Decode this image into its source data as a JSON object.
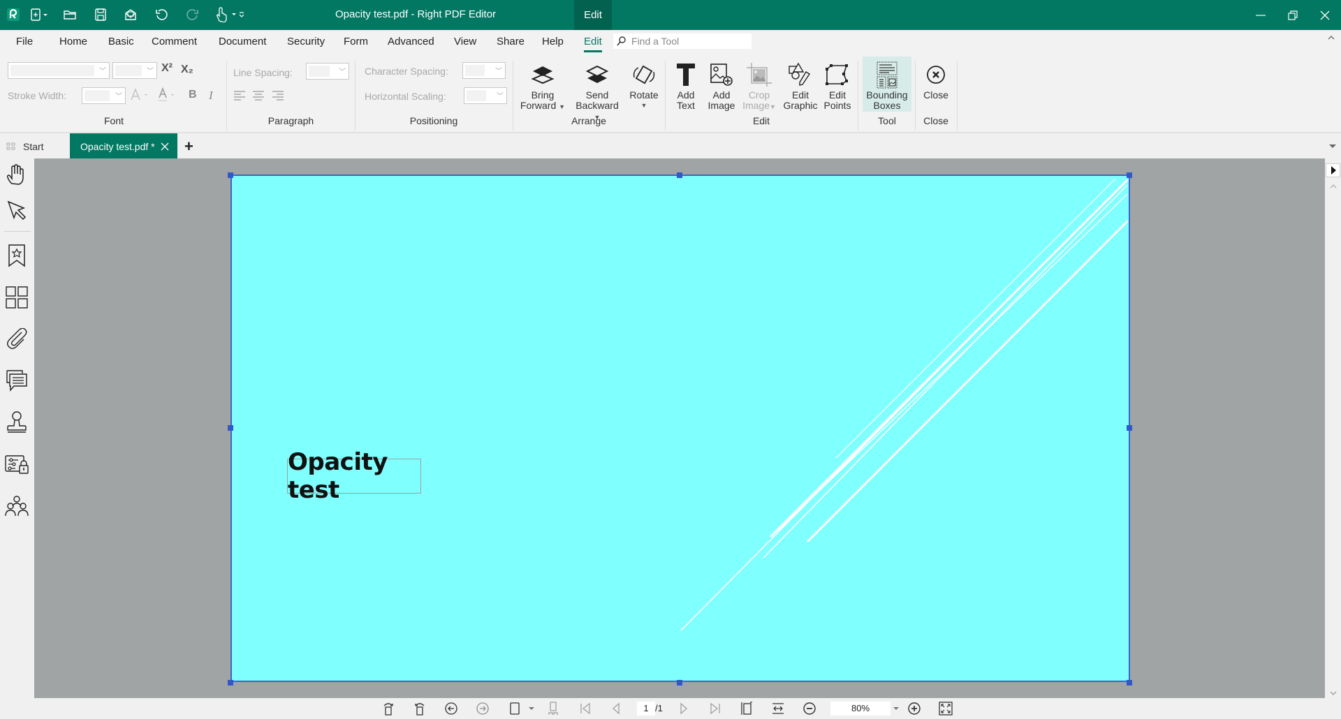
{
  "app": {
    "title": "Opacity test.pdf - Right PDF Editor",
    "context_tab": "Edit",
    "colors": {
      "brand": "#027862",
      "page_fill": "#80ffff",
      "selection": "#3d65c8"
    }
  },
  "quick_access": [
    "app-logo-icon",
    "new-document-icon",
    "open-folder-icon",
    "save-icon",
    "print-icon",
    "undo-icon",
    "redo-icon",
    "hand-tool-icon",
    "customize-icon"
  ],
  "menu": {
    "items": [
      {
        "label": "File"
      },
      {
        "label": "Home"
      },
      {
        "label": "Basic"
      },
      {
        "label": "Comment"
      },
      {
        "label": "Document"
      },
      {
        "label": "Security"
      },
      {
        "label": "Form"
      },
      {
        "label": "Advanced"
      },
      {
        "label": "View"
      },
      {
        "label": "Share"
      },
      {
        "label": "Help"
      },
      {
        "label": "Edit",
        "active": true
      }
    ],
    "search_placeholder": "Find a Tool"
  },
  "ribbon": {
    "font": {
      "group_label": "Font",
      "font_name_value": "",
      "font_size_value": "",
      "stroke_width_label": "Stroke Width:",
      "superscript": "X²",
      "subscript": "X₂",
      "bold": "B",
      "italic": "I"
    },
    "paragraph": {
      "group_label": "Paragraph",
      "line_spacing_label": "Line Spacing:"
    },
    "positioning": {
      "group_label": "Positioning",
      "char_spacing_label": "Character Spacing:",
      "horiz_scaling_label": "Horizontal Scaling:"
    },
    "arrange": {
      "group_label": "Arrange",
      "bring_forward": [
        "Bring",
        "Forward"
      ],
      "send_backward": [
        "Send",
        "Backward"
      ],
      "rotate": "Rotate"
    },
    "edit": {
      "group_label": "Edit",
      "add_text": [
        "Add",
        "Text"
      ],
      "add_image": [
        "Add",
        "Image"
      ],
      "crop_image": [
        "Crop",
        "Image"
      ],
      "edit_graphic": [
        "Edit",
        "Graphic"
      ],
      "edit_points": [
        "Edit",
        "Points"
      ]
    },
    "tool": {
      "group_label": "Tool",
      "bounding_boxes": [
        "Bounding",
        "Boxes"
      ]
    },
    "close": {
      "group_label": "Close",
      "close": "Close"
    }
  },
  "tabs": {
    "start": "Start",
    "document": "Opacity test.pdf *",
    "add": "+"
  },
  "document": {
    "text_object": "Opacity test",
    "background_color": "#80ffff",
    "line_color": "#ffffff"
  },
  "statusbar": {
    "current_page": "1",
    "total_pages": "/1",
    "zoom": "80%"
  }
}
